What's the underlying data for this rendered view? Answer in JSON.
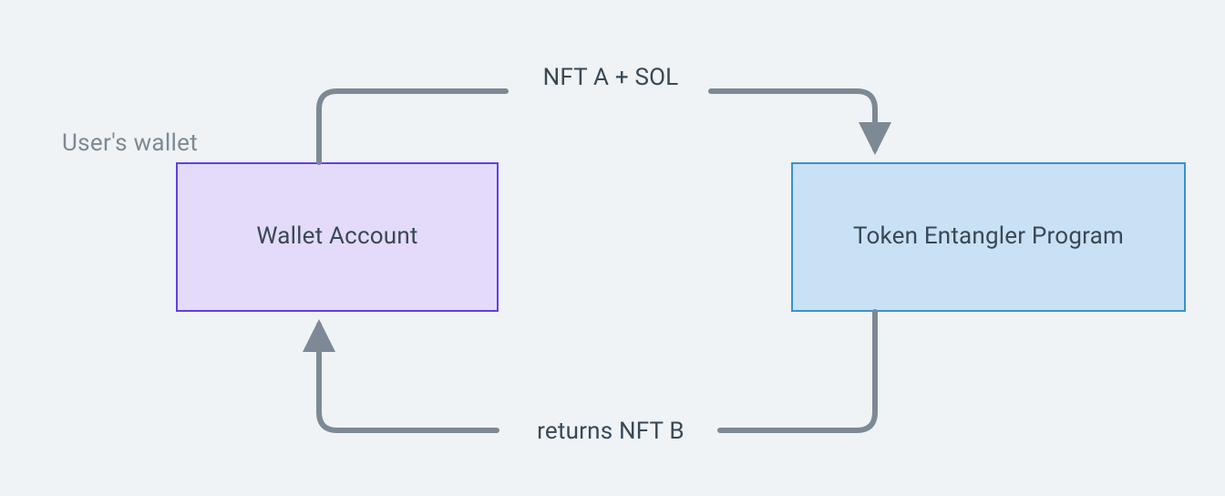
{
  "annotations": {
    "wallet_caption": "User's wallet"
  },
  "nodes": {
    "wallet": {
      "label": "Wallet Account"
    },
    "program": {
      "label": "Token Entangler Program"
    }
  },
  "edges": {
    "wallet_to_program": {
      "label": "NFT A + SOL"
    },
    "program_to_wallet": {
      "label": "returns NFT B"
    }
  },
  "colors": {
    "background": "#eff3f5",
    "wallet_fill": "#e4dbfb",
    "wallet_border": "#6140e4",
    "program_fill": "#c9e1f5",
    "program_border": "#3792d0",
    "arrow": "#7d8994",
    "text": "#394856",
    "caption": "#7d8994"
  }
}
